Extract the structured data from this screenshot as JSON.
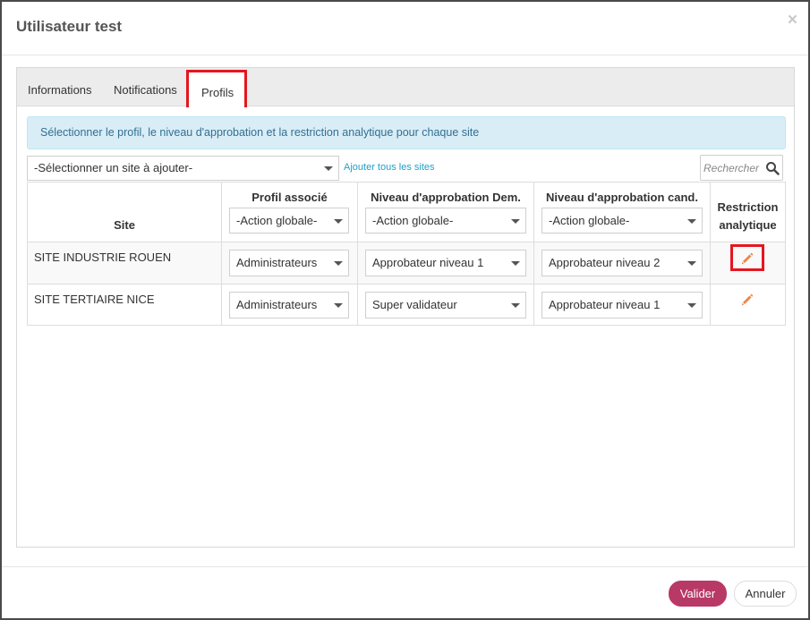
{
  "modal": {
    "title": "Utilisateur test",
    "close_label": "×"
  },
  "tabs": [
    {
      "label": "Informations"
    },
    {
      "label": "Notifications"
    },
    {
      "label": "Profils"
    }
  ],
  "alert": {
    "text": "Sélectionner le profil, le niveau d'approbation et la restriction analytique pour chaque site"
  },
  "site_select": {
    "value": "-Sélectionner un site à ajouter-"
  },
  "add_all_link": "Ajouter tous les sites",
  "search": {
    "placeholder": "Rechercher"
  },
  "table": {
    "headers": {
      "site": "Site",
      "profile": "Profil associé",
      "dem_level": "Niveau d'approbation Dem.",
      "cand_level": "Niveau d'approbation cand.",
      "restriction_line1": "Restriction",
      "restriction_line2": "analytique"
    },
    "global_action": "-Action globale-",
    "rows": [
      {
        "site": "SITE INDUSTRIE ROUEN",
        "profile": "Administrateurs",
        "dem_level": "Approbateur niveau 1",
        "cand_level": "Approbateur niveau 2"
      },
      {
        "site": "SITE TERTIAIRE NICE",
        "profile": "Administrateurs",
        "dem_level": "Super validateur",
        "cand_level": "Approbateur niveau 1"
      }
    ]
  },
  "footer": {
    "validate_label": "Valider",
    "cancel_label": "Annuler"
  },
  "colors": {
    "highlight": "#e5161f",
    "primary": "#b83966",
    "link": "#1fa1c8",
    "info_bg": "#d9edf7",
    "info_text": "#31708f",
    "edit_icon": "#f0834a"
  },
  "icons": {
    "search": "search-icon",
    "edit": "pencil-icon",
    "close": "close-icon"
  }
}
